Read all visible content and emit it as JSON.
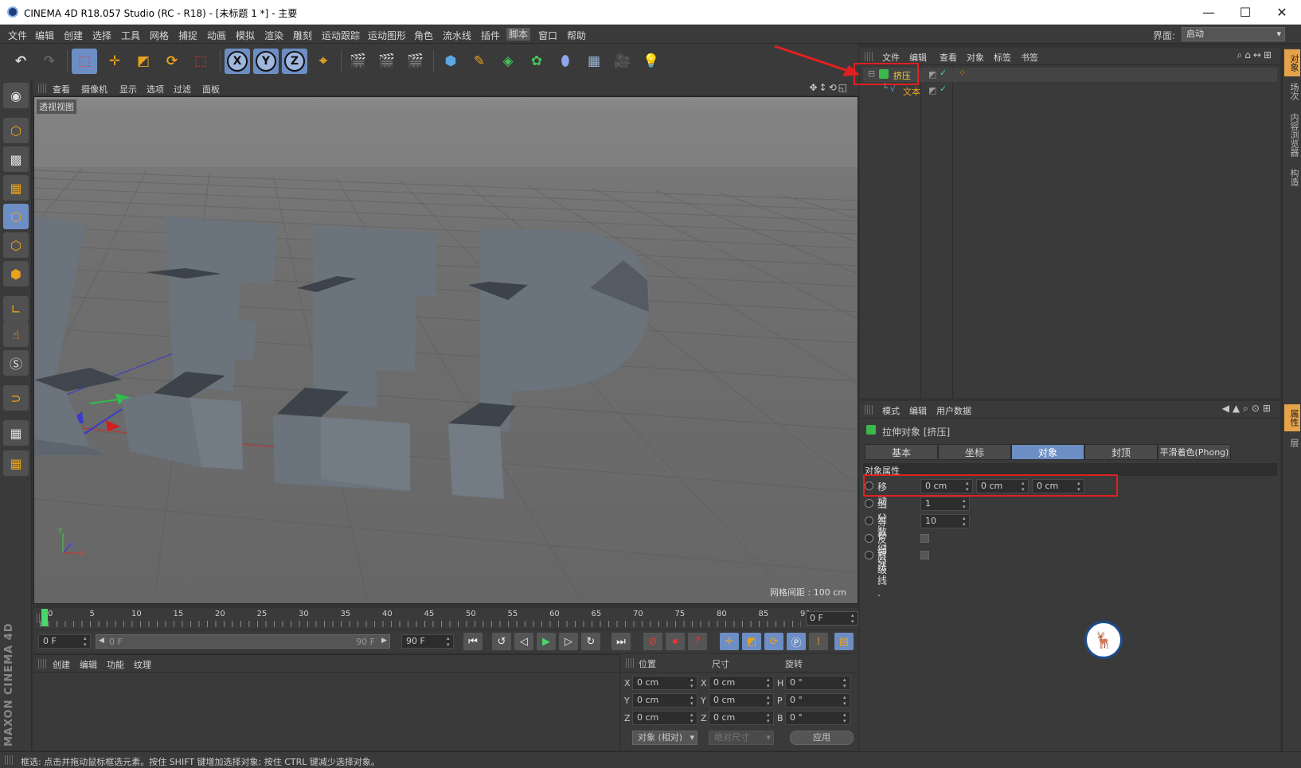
{
  "window": {
    "title": "CINEMA 4D R18.057 Studio (RC - R18) - [未标题 1 *] - 主要",
    "minimize": "—",
    "maximize": "☐",
    "close": "✕"
  },
  "menu": [
    "文件",
    "编辑",
    "创建",
    "选择",
    "工具",
    "网格",
    "捕捉",
    "动画",
    "模拟",
    "渲染",
    "雕刻",
    "运动跟踪",
    "运动图形",
    "角色",
    "流水线",
    "插件",
    "脚本",
    "窗口",
    "帮助"
  ],
  "menu_active_index": 16,
  "layout": {
    "label": "界面:",
    "value": "启动"
  },
  "viewport": {
    "menu": [
      "查看",
      "摄像机",
      "显示",
      "选项",
      "过滤",
      "面板"
    ],
    "label": "透视视图",
    "grid_spacing": "网格间距 : 100 cm",
    "axis": {
      "y": "Y",
      "z": "Z",
      "x": "X"
    },
    "letters": [
      "K",
      "E",
      "E",
      "P"
    ]
  },
  "timeline": {
    "ticks": [
      "0",
      "5",
      "10",
      "15",
      "20",
      "25",
      "30",
      "35",
      "40",
      "45",
      "50",
      "55",
      "60",
      "65",
      "70",
      "75",
      "80",
      "85",
      "90"
    ],
    "current": "0 F"
  },
  "transport": {
    "start": "0 F",
    "range_start": "0 F",
    "range_end": "90 F",
    "end": "90 F"
  },
  "material": {
    "menu": [
      "创建",
      "编辑",
      "功能",
      "纹理"
    ]
  },
  "coordinates": {
    "headers": [
      "位置",
      "尺寸",
      "旋转"
    ],
    "rows": [
      {
        "a": "X",
        "pos": "0 cm",
        "b": "X",
        "size": "0 cm",
        "c": "H",
        "rot": "0 °"
      },
      {
        "a": "Y",
        "pos": "0 cm",
        "b": "Y",
        "size": "0 cm",
        "c": "P",
        "rot": "0 °"
      },
      {
        "a": "Z",
        "pos": "0 cm",
        "b": "Z",
        "size": "0 cm",
        "c": "B",
        "rot": "0 °"
      }
    ],
    "mode": "对象 (相对)",
    "size_mode": "绝对尺寸",
    "apply": "应用"
  },
  "objects": {
    "menu": [
      "文件",
      "编辑",
      "查看",
      "对象",
      "标签",
      "书签"
    ],
    "items": [
      {
        "name": "挤压"
      },
      {
        "name": "文本"
      }
    ]
  },
  "attributes": {
    "menu": [
      "模式",
      "编辑",
      "用户数据"
    ],
    "title": "拉伸对象 [挤压]",
    "tabs": [
      "基本",
      "坐标",
      "对象",
      "封顶",
      "平滑着色(Phong)"
    ],
    "active_tab": 2,
    "section": "对象属性",
    "props": {
      "move": {
        "label": "移动 . . .",
        "x": "0 cm",
        "y": "0 cm",
        "z": "0 cm"
      },
      "subdiv": {
        "label": "细分数 . .",
        "value": "1"
      },
      "isoparm": {
        "label": "等参细分",
        "value": "10"
      },
      "flip": {
        "label": "反转法线"
      },
      "hierarchy": {
        "label": "层级 . . ."
      }
    }
  },
  "right_tabs": [
    "对象",
    "场次",
    "内容浏览器",
    "构造",
    "属性",
    "层"
  ],
  "status": "框选: 点击并拖动鼠标框选元素。按住 SHIFT 键增加选择对象; 按住 CTRL 键减少选择对象。",
  "brand": "MAXON CINEMA 4D",
  "colors": {
    "accent": "#6d8ec4",
    "annotation": "#e02020",
    "playhead": "#4bd66b"
  }
}
